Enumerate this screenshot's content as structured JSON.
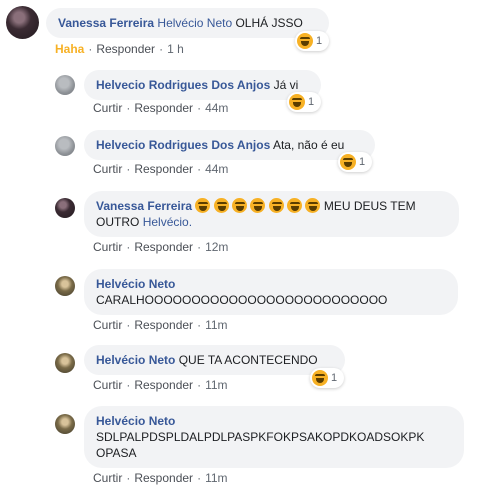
{
  "comments": [
    {
      "author": "Vanessa Ferreira",
      "mention": "Helvécio Neto",
      "text": "OLHÁ JSSO",
      "reaction_count": "1",
      "reaction_label": "Haha",
      "reply_label": "Responder",
      "time": "1 h"
    },
    {
      "author": "Helvecio Rodrigues Dos Anjos",
      "text": "Já vi",
      "reaction_count": "1",
      "like_label": "Curtir",
      "reply_label": "Responder",
      "time": "44m"
    },
    {
      "author": "Helvecio Rodrigues Dos Anjos",
      "text": "Ata, não é eu",
      "reaction_count": "1",
      "like_label": "Curtir",
      "reply_label": "Responder",
      "time": "44m"
    },
    {
      "author": "Vanessa Ferreira",
      "text_after_emojis": "MEU DEUS TEM",
      "text_line2": "OUTRO",
      "mention": "Helvécio.",
      "like_label": "Curtir",
      "reply_label": "Responder",
      "time": "12m"
    },
    {
      "author": "Helvécio Neto",
      "text": "CARALHOOOOOOOOOOOOOOOOOOOOOOOOOO",
      "like_label": "Curtir",
      "reply_label": "Responder",
      "time": "11m"
    },
    {
      "author": "Helvécio Neto",
      "text": "QUE TA ACONTECENDO",
      "reaction_count": "1",
      "like_label": "Curtir",
      "reply_label": "Responder",
      "time": "11m"
    },
    {
      "author": "Helvécio Neto",
      "text": "SDLPALPDSPLDALPDLPASPKFOKPSAKOPDKOADSOKPK",
      "text_line2": "OPASA",
      "like_label": "Curtir",
      "reply_label": "Responder",
      "time": "11m"
    }
  ],
  "separator": "·",
  "icons": {
    "reaction": "haha-emoji-icon",
    "avatar": "avatar-icon"
  },
  "colors": {
    "name": "#385898",
    "bubble": "#f2f3f5",
    "haha": "#f7b125",
    "meta": "#606770"
  }
}
